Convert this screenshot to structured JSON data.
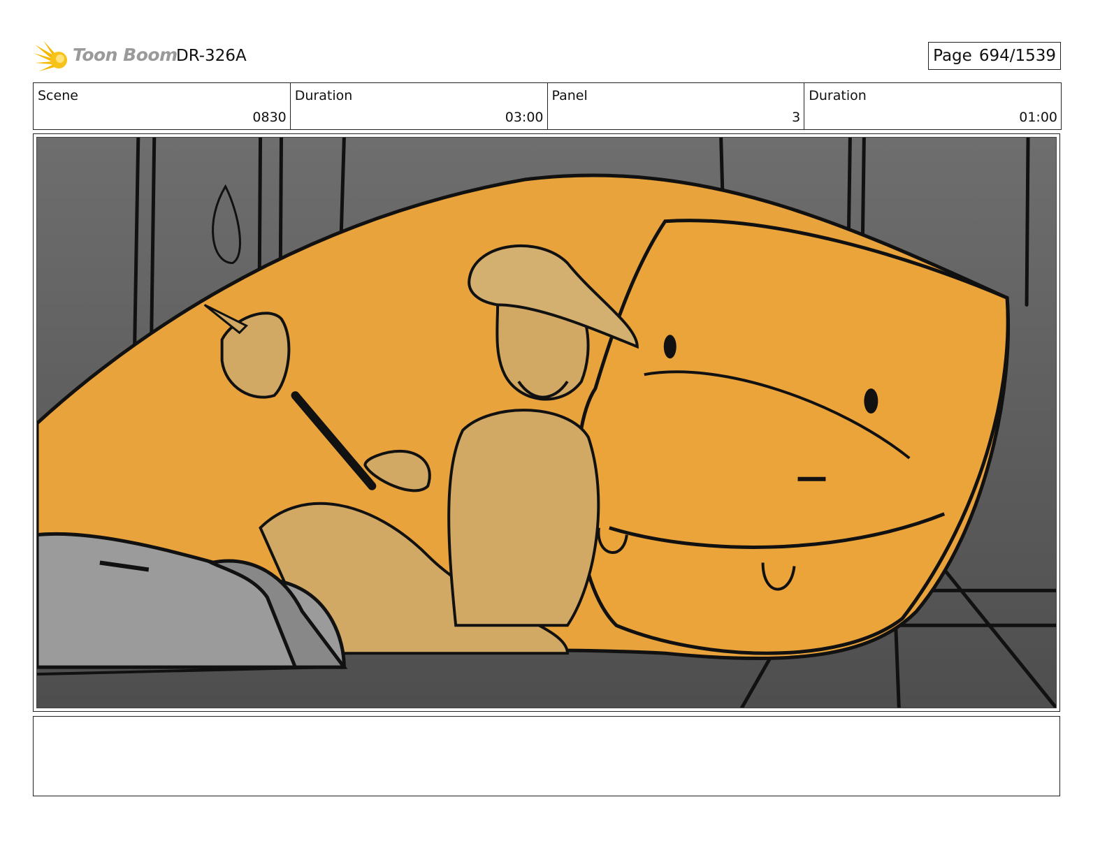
{
  "header": {
    "brand": "Toon Boom",
    "doc_id": "DR-326A",
    "page_label": "Page",
    "page_value": "694/1539"
  },
  "info": {
    "scene_label": "Scene",
    "scene_value": "0830",
    "duration_label": "Duration",
    "duration_value": "03:00",
    "panel_label": "Panel",
    "panel_value": "3",
    "panel_duration_label": "Duration",
    "panel_duration_value": "01:00"
  },
  "panel_image": {
    "icon": "storyboard-sketch",
    "colors": {
      "background": "#5f5f5f",
      "creature": "#e8a33c",
      "character": "#d1a964",
      "glow": "#f07a2a",
      "rock": "#9b9b9b"
    }
  },
  "notes": {
    "text": ""
  }
}
